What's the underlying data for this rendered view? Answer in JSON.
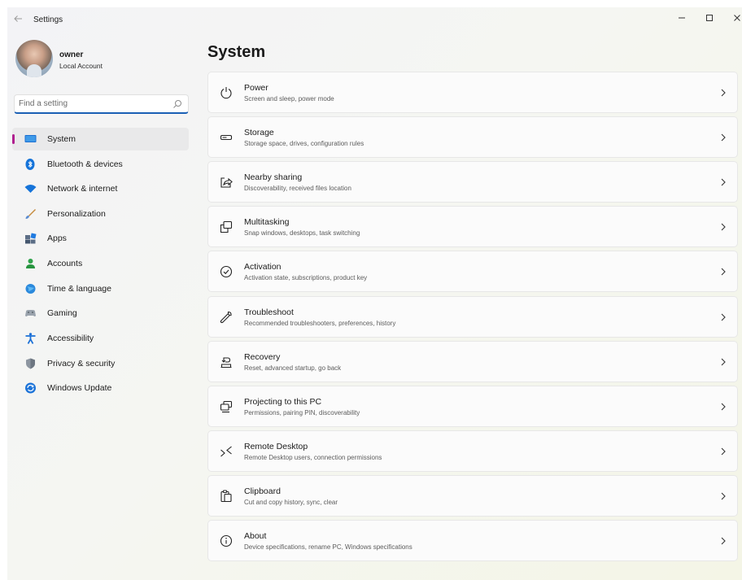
{
  "window": {
    "title": "Settings"
  },
  "profile": {
    "name": "owner",
    "account_type": "Local Account"
  },
  "search": {
    "placeholder": "Find a setting"
  },
  "sidebar": {
    "items": [
      {
        "label": "System",
        "icon": "system-monitor-icon",
        "selected": true
      },
      {
        "label": "Bluetooth & devices",
        "icon": "bluetooth-icon"
      },
      {
        "label": "Network & internet",
        "icon": "wifi-icon"
      },
      {
        "label": "Personalization",
        "icon": "brush-icon"
      },
      {
        "label": "Apps",
        "icon": "apps-icon"
      },
      {
        "label": "Accounts",
        "icon": "accounts-icon"
      },
      {
        "label": "Time & language",
        "icon": "time-language-icon"
      },
      {
        "label": "Gaming",
        "icon": "gamepad-icon"
      },
      {
        "label": "Accessibility",
        "icon": "accessibility-icon"
      },
      {
        "label": "Privacy & security",
        "icon": "shield-icon"
      },
      {
        "label": "Windows Update",
        "icon": "update-icon"
      }
    ]
  },
  "main": {
    "title": "System",
    "cards": [
      {
        "title": "Power",
        "subtitle": "Screen and sleep, power mode",
        "icon": "power-icon"
      },
      {
        "title": "Storage",
        "subtitle": "Storage space, drives, configuration rules",
        "icon": "storage-icon"
      },
      {
        "title": "Nearby sharing",
        "subtitle": "Discoverability, received files location",
        "icon": "share-icon"
      },
      {
        "title": "Multitasking",
        "subtitle": "Snap windows, desktops, task switching",
        "icon": "multitasking-icon"
      },
      {
        "title": "Activation",
        "subtitle": "Activation state, subscriptions, product key",
        "icon": "check-circle-icon"
      },
      {
        "title": "Troubleshoot",
        "subtitle": "Recommended troubleshooters, preferences, history",
        "icon": "wrench-icon"
      },
      {
        "title": "Recovery",
        "subtitle": "Reset, advanced startup, go back",
        "icon": "recovery-icon"
      },
      {
        "title": "Projecting to this PC",
        "subtitle": "Permissions, pairing PIN, discoverability",
        "icon": "projecting-icon"
      },
      {
        "title": "Remote Desktop",
        "subtitle": "Remote Desktop users, connection permissions",
        "icon": "remote-desktop-icon"
      },
      {
        "title": "Clipboard",
        "subtitle": "Cut and copy history, sync, clear",
        "icon": "clipboard-icon"
      },
      {
        "title": "About",
        "subtitle": "Device specifications, rename PC, Windows specifications",
        "icon": "info-icon"
      }
    ]
  },
  "colors": {
    "accent": "#1a5fb4",
    "selection_indicator": "#b01f8f"
  }
}
